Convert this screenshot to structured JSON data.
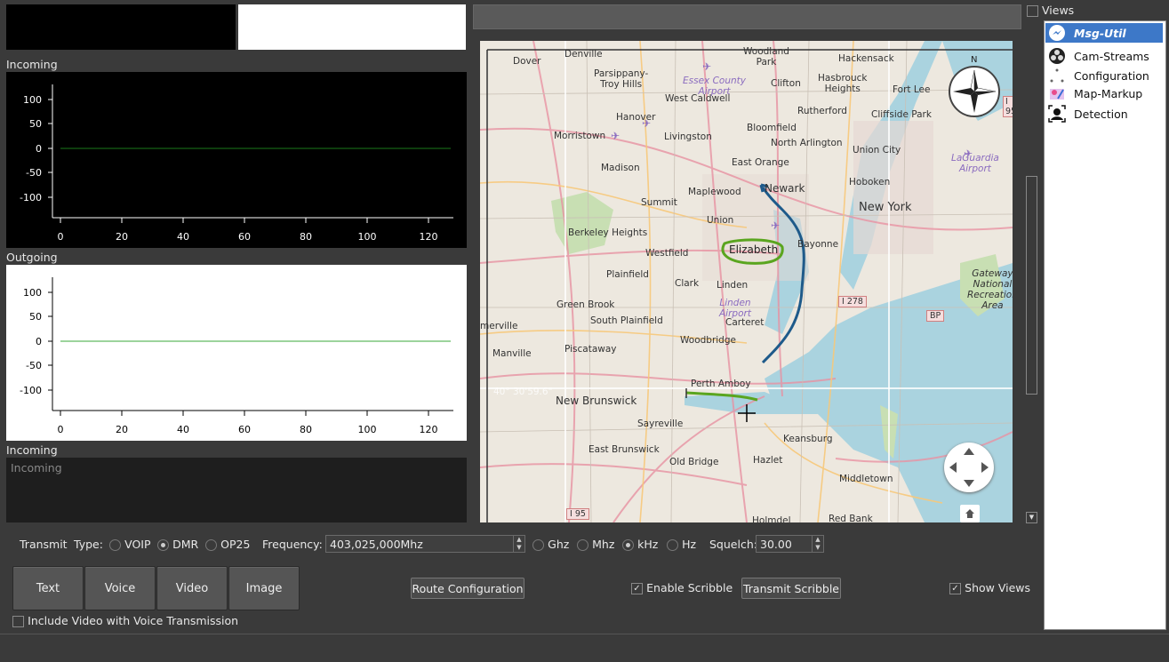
{
  "top_panels": {
    "left_color": "#000000",
    "right_color": "#ffffff"
  },
  "incoming_plot": {
    "label": "Incoming",
    "bg": "#000000",
    "fg": "#ffffff",
    "line_color": "#1a7a1a",
    "y_ticks": [
      "100",
      "50",
      "0",
      "-50",
      "-100"
    ],
    "x_ticks": [
      "0",
      "20",
      "40",
      "60",
      "80",
      "100",
      "120"
    ]
  },
  "outgoing_plot": {
    "label": "Outgoing",
    "bg": "#ffffff",
    "fg": "#000000",
    "line_color": "#3aaa3a",
    "y_ticks": [
      "100",
      "50",
      "0",
      "-50",
      "-100"
    ],
    "x_ticks": [
      "0",
      "20",
      "40",
      "60",
      "80",
      "100",
      "120"
    ]
  },
  "incoming_text": {
    "label": "Incoming",
    "placeholder": "Incoming"
  },
  "map": {
    "places": [
      "Denville",
      "Dover",
      "Parsippany-\nTroy Hills",
      "Essex County\nAirport",
      "Woodland\nPark",
      "Clifton",
      "Hackensack",
      "Hasbrouck\nHeights",
      "Fort Lee",
      "West Caldwell",
      "Hanover",
      "Rutherford",
      "Cliffside Park",
      "Morristown",
      "Livingston",
      "Bloomfield",
      "North Arlington",
      "Union City",
      "Madison",
      "East Orange",
      "Hoboken",
      "LaGuardia\nAirport",
      "Newark",
      "New York",
      "Maplewood",
      "Summit",
      "Union",
      "Berkeley Heights",
      "Bayonne",
      "Elizabeth",
      "Westfield",
      "Plainfield",
      "Clark",
      "Linden",
      "Linden\nAirport",
      "Carteret",
      "Green Brook",
      "South Plainfield",
      "Gateway\nNational\nRecreation\nArea",
      "Piscataway",
      "Woodbridge",
      "Manville",
      "merville",
      "Perth Amboy",
      "New Brunswick",
      "Sayreville",
      "East Brunswick",
      "Old Bridge",
      "Keansburg",
      "Hazlet",
      "Middletown",
      "Holmdel",
      "Red Bank"
    ],
    "shields": [
      "I 278",
      "BP",
      "I 95",
      "I 95"
    ],
    "coord_text": "40° 30'59.6\"",
    "compass_label": "N"
  },
  "views": {
    "title": "Views",
    "items": [
      {
        "label": "Msg-Util",
        "selected": true,
        "icon": "messenger-icon"
      },
      {
        "label": "Cam-Streams",
        "selected": false,
        "icon": "obs-icon"
      },
      {
        "label": "Configuration",
        "selected": false,
        "icon": "dots-icon"
      },
      {
        "label": "Map-Markup",
        "selected": false,
        "icon": "map-markup-icon"
      },
      {
        "label": "Detection",
        "selected": false,
        "icon": "detection-icon"
      }
    ]
  },
  "transmit": {
    "label": "Transmit",
    "type_label": "Type:",
    "types": [
      {
        "label": "VOIP",
        "on": false
      },
      {
        "label": "DMR",
        "on": true
      },
      {
        "label": "OP25",
        "on": false
      }
    ],
    "frequency_label": "Frequency:",
    "frequency_value": "403,025,000Mhz",
    "units": [
      {
        "label": "Ghz",
        "on": false
      },
      {
        "label": "Mhz",
        "on": false
      },
      {
        "label": "kHz",
        "on": true
      },
      {
        "label": "Hz",
        "on": false
      }
    ],
    "squelch_label": "Squelch:",
    "squelch_value": "30.00"
  },
  "buttons": {
    "text": "Text",
    "voice": "Voice",
    "video": "Video",
    "image": "Image",
    "route": "Route Configuration",
    "transmit_scribble": "Transmit Scribble"
  },
  "checks": {
    "enable_scribble": "Enable Scribble",
    "enable_scribble_on": true,
    "show_views": "Show Views",
    "show_views_on": true,
    "include_video": "Include Video with Voice Transmission",
    "include_video_on": false
  },
  "colors": {
    "accent": "#3d78c8",
    "window_bg": "#3a3a3a"
  }
}
